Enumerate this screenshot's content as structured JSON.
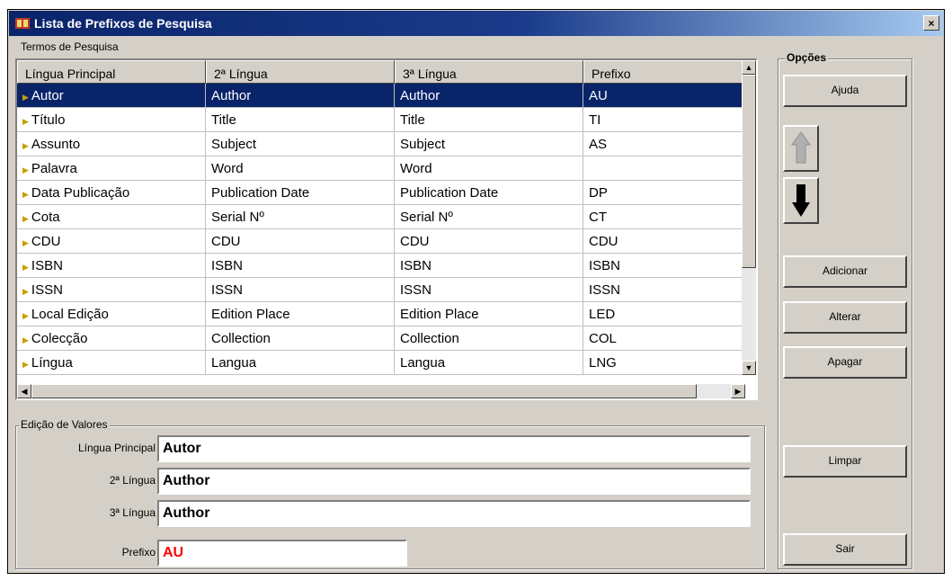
{
  "window": {
    "title": "Lista de Prefixos de Pesquisa",
    "close_glyph": "×",
    "icon": "app-icon"
  },
  "search_terms": {
    "group_label": "Termos de Pesquisa",
    "columns": [
      "Língua Principal",
      "2ª Língua",
      "3ª Língua",
      "Prefixo"
    ],
    "rows": [
      {
        "main": "Autor",
        "second": "Author",
        "third": "Author",
        "prefix": "AU",
        "selected": true
      },
      {
        "main": "Título",
        "second": "Title",
        "third": "Title",
        "prefix": "TI"
      },
      {
        "main": "Assunto",
        "second": "Subject",
        "third": "Subject",
        "prefix": "AS"
      },
      {
        "main": "Palavra",
        "second": "Word",
        "third": "Word",
        "prefix": ""
      },
      {
        "main": "Data Publicação",
        "second": "Publication Date",
        "third": "Publication Date",
        "prefix": "DP"
      },
      {
        "main": "Cota",
        "second": "Serial Nº",
        "third": "Serial Nº",
        "prefix": "CT"
      },
      {
        "main": "CDU",
        "second": "CDU",
        "third": "CDU",
        "prefix": "CDU"
      },
      {
        "main": "ISBN",
        "second": "ISBN",
        "third": "ISBN",
        "prefix": "ISBN"
      },
      {
        "main": "ISSN",
        "second": "ISSN",
        "third": "ISSN",
        "prefix": "ISSN"
      },
      {
        "main": "Local Edição",
        "second": "Edition Place",
        "third": "Edition Place",
        "prefix": "LED"
      },
      {
        "main": "Colecção",
        "second": "Collection",
        "third": "Collection",
        "prefix": "COL"
      },
      {
        "main": "Língua",
        "second": "Langua",
        "third": "Langua",
        "prefix": "LNG"
      }
    ]
  },
  "edit": {
    "group_label": "Edição de Valores",
    "main_label": "Língua Principal",
    "main_value": "Autor",
    "second_label": "2ª Língua",
    "second_value": "Author",
    "third_label": "3ª Língua",
    "third_value": "Author",
    "prefix_label": "Prefixo",
    "prefix_value": "AU",
    "prefix_color": "#ff0000"
  },
  "options": {
    "group_label": "Opções",
    "help": "Ajuda",
    "up_icon": "arrow-up-icon",
    "down_icon": "arrow-down-icon",
    "add": "Adicionar",
    "change": "Alterar",
    "delete": "Apagar",
    "clear": "Limpar",
    "exit": "Sair"
  },
  "colors": {
    "selection": "#0a246a",
    "face": "#d4d0c8"
  }
}
